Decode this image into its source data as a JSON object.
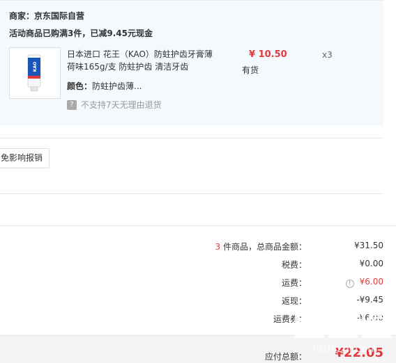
{
  "shop": {
    "merchant": "商家：京东国际自营",
    "promo": "活动商品已购满3件，已减9.45元现金"
  },
  "product": {
    "name": "日本进口 花王（KAO）防蛀护齿牙膏薄荷味165g/支 防蛀护齿 清洁牙齿",
    "color_label": "颜色：",
    "color_value": "防蛀护齿薄...",
    "price": "¥ 10.50",
    "stock": "有货",
    "qty": "x3",
    "no_return": "不支持7天无理由退货",
    "no_return_icon": "no-return-icon",
    "thumb_brand": "KAO"
  },
  "invoice": {
    "button_label": "免影响报销"
  },
  "summary": {
    "count": "3",
    "count_suffix": " 件商品，总商品金额：",
    "subtotal": "¥31.50",
    "tax_label": "税费：",
    "tax": "¥0.00",
    "shipping_label": "运费：",
    "shipping": "¥6.00",
    "rebate_label": "返现：",
    "rebate": "-¥9.45",
    "ship_discount_label": "运费券：",
    "ship_discount": "-¥6.00"
  },
  "footer": {
    "payable_label": "应付总额：",
    "payable": "¥22.05"
  },
  "watermark": {
    "logo": "值",
    "domain": "hizhizhi.com"
  },
  "colors": {
    "accent": "#e4393c",
    "panel_bg": "#f3f9fd"
  }
}
